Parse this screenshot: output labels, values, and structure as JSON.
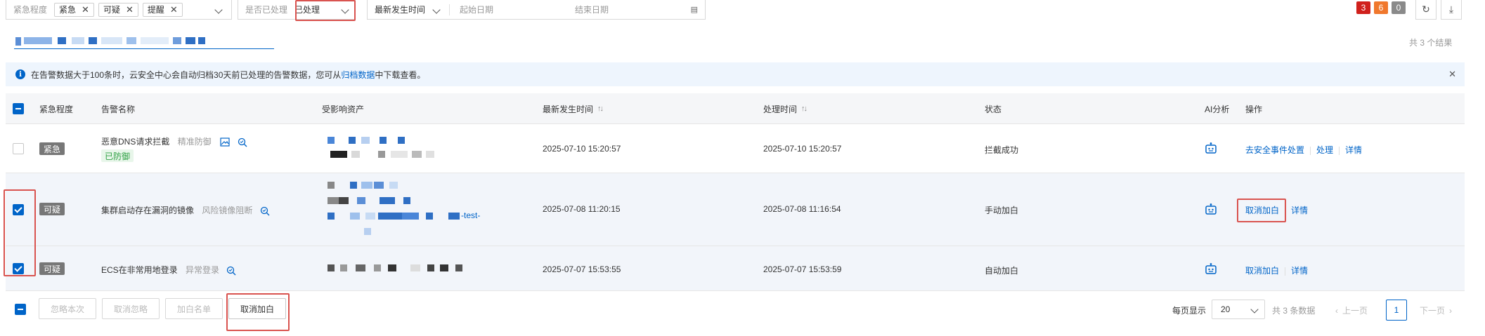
{
  "filters": {
    "urgency_label": "紧急程度",
    "urgency_tags": [
      "紧急",
      "可疑",
      "提醒"
    ],
    "processed_label": "是否已处理",
    "processed_value": "已处理",
    "time_sort": "最新发生时间",
    "start_date_placeholder": "起始日期",
    "end_date_placeholder": "结束日期"
  },
  "counts": [
    {
      "value": "3",
      "color": "#d0201c"
    },
    {
      "value": "6",
      "color": "#f0782d"
    },
    {
      "value": "0",
      "color": "#8a8a8a"
    }
  ],
  "result_count": "共 3 个结果",
  "notice": {
    "text_before": "在告警数据大于100条时，云安全中心会自动归档30天前已处理的告警数据，您可从",
    "link": "归档数据",
    "text_after": "中下载查看。"
  },
  "table": {
    "headers": {
      "urgency": "紧急程度",
      "name": "告警名称",
      "asset": "受影响资产",
      "latest_time": "最新发生时间",
      "process_time": "处理时间",
      "status": "状态",
      "ai": "AI分析",
      "ops": "操作"
    },
    "rows": [
      {
        "level": "紧急",
        "name": "恶意DNS请求拦截",
        "sub": "精准防御",
        "tag": "已防御",
        "latest_time": "2025-07-10 15:20:57",
        "process_time": "2025-07-10 15:20:57",
        "status": "拦截成功",
        "ops": [
          "去安全事件处置",
          "处理",
          "详情"
        ]
      },
      {
        "level": "可疑",
        "name": "集群启动存在漏洞的镜像",
        "sub": "风险镜像阻断",
        "asset_suffix": "-test-",
        "latest_time": "2025-07-08 11:20:15",
        "process_time": "2025-07-08 11:16:54",
        "status": "手动加白",
        "ops": [
          "取消加白",
          "详情"
        ]
      },
      {
        "level": "可疑",
        "name": "ECS在非常用地登录",
        "sub": "异常登录",
        "latest_time": "2025-07-07 15:53:55",
        "process_time": "2025-07-07 15:53:59",
        "status": "自动加白",
        "ops": [
          "取消加白",
          "详情"
        ]
      }
    ]
  },
  "footer": {
    "buttons": [
      "忽略本次",
      "取消忽略",
      "加白名单",
      "取消加白"
    ],
    "per_page_label": "每页显示",
    "per_page_value": "20",
    "total": "共 3 条数据",
    "prev": "上一页",
    "page": "1",
    "next": "下一页"
  }
}
